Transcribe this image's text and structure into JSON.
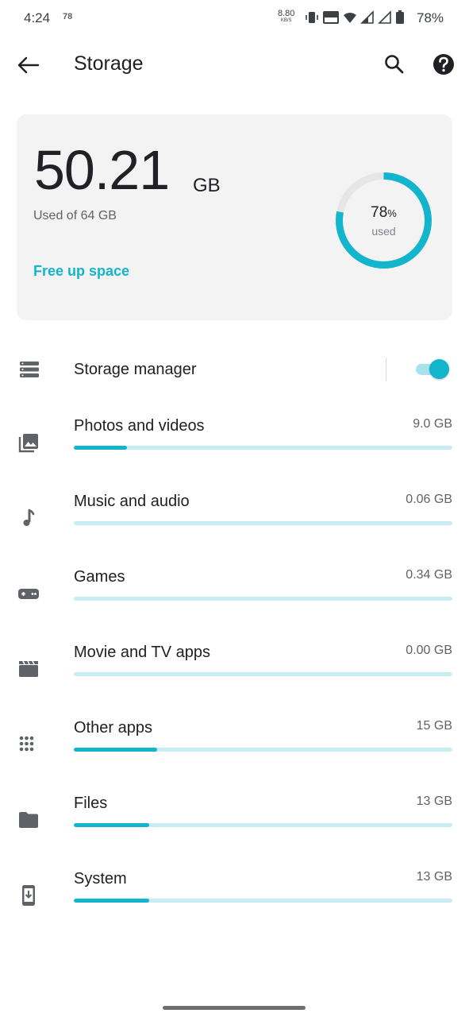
{
  "status_bar": {
    "time": "4:24",
    "notification": "78",
    "net_speed": "8.80",
    "net_speed_unit": "KB/S",
    "battery": "78%"
  },
  "app_bar": {
    "title": "Storage",
    "icons": [
      "back-arrow-icon",
      "search-icon",
      "help-icon"
    ]
  },
  "summary": {
    "used_value": "50.21",
    "used_unit": "GB",
    "used_of": "Used of 64 GB",
    "percent_value": "78",
    "percent_symbol": "%",
    "percent_label": "used",
    "percent_fraction": 0.78,
    "action": "Free up space"
  },
  "storage_manager": {
    "label": "Storage manager",
    "enabled": true
  },
  "categories": [
    {
      "label": "Photos and videos",
      "size": "9.0 GB",
      "fraction": 0.14,
      "icon": "photo-library-icon"
    },
    {
      "label": "Music and audio",
      "size": "0.06 GB",
      "fraction": 0.0,
      "icon": "music-note-icon"
    },
    {
      "label": "Games",
      "size": "0.34 GB",
      "fraction": 0.0,
      "icon": "gamepad-icon"
    },
    {
      "label": "Movie and TV apps",
      "size": "0.00 GB",
      "fraction": 0.0,
      "icon": "movie-icon"
    },
    {
      "label": "Other apps",
      "size": "15 GB",
      "fraction": 0.22,
      "icon": "apps-grid-icon"
    },
    {
      "label": "Files",
      "size": "13 GB",
      "fraction": 0.2,
      "icon": "folder-icon"
    },
    {
      "label": "System",
      "size": "13 GB",
      "fraction": 0.2,
      "icon": "system-update-icon"
    }
  ],
  "colors": {
    "accent": "#12b5cb",
    "track": "#c7edf2",
    "card_bg": "#f3f3f3",
    "ring_bg": "#e6e6e6"
  }
}
